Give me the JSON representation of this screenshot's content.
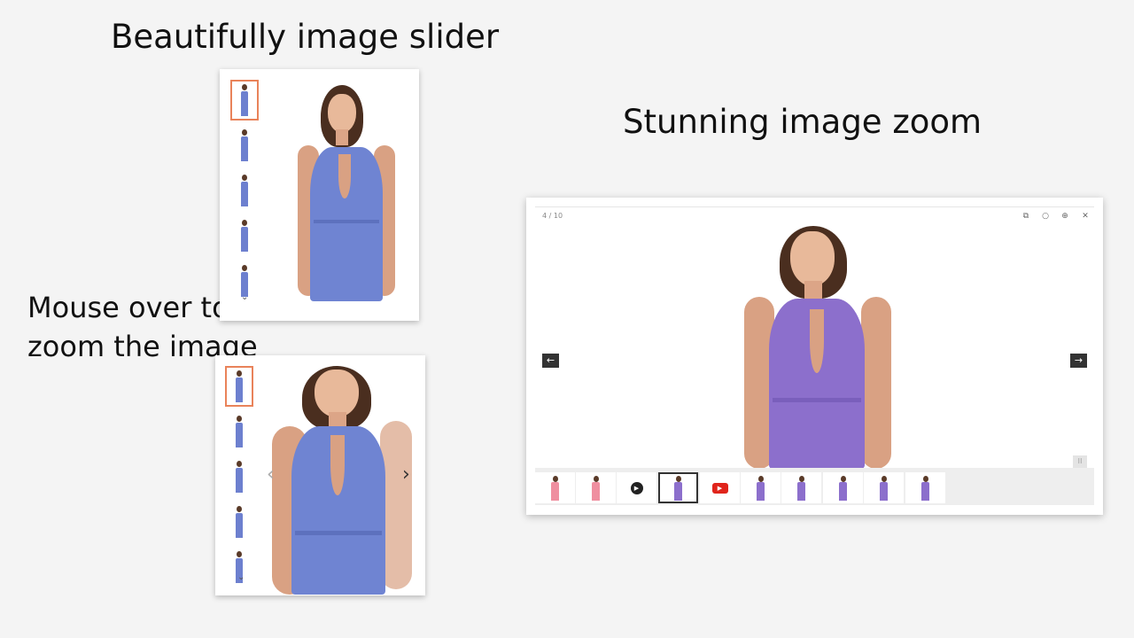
{
  "headings": {
    "slider": "Beautifully image slider",
    "zoom": "Stunning image zoom",
    "hover_line1": "Mouse over to",
    "hover_line2": "zoom the image"
  },
  "viewer": {
    "counter": "4 / 10",
    "tools": [
      "fullscreen-icon",
      "zoom-out-icon",
      "zoom-in-icon",
      "close-icon"
    ],
    "prev_icon": "←",
    "next_icon": "→",
    "thumbnails": [
      {
        "kind": "image",
        "color": "#ef8fa0"
      },
      {
        "kind": "image",
        "color": "#ef8fa0"
      },
      {
        "kind": "video",
        "icon": "play-icon"
      },
      {
        "kind": "image",
        "color": "#8c6fcc",
        "active": true
      },
      {
        "kind": "video",
        "icon": "youtube-icon"
      },
      {
        "kind": "image",
        "color": "#8c6fcc"
      },
      {
        "kind": "image",
        "color": "#8c6fcc"
      },
      {
        "kind": "image",
        "color": "#8c6fcc"
      },
      {
        "kind": "image",
        "color": "#8c6fcc"
      },
      {
        "kind": "image",
        "color": "#8c6fcc"
      }
    ]
  },
  "colors": {
    "dress_blue": "#6f84d2",
    "dress_purple": "#8c6fcc",
    "active_thumb_border": "#e9835a"
  }
}
